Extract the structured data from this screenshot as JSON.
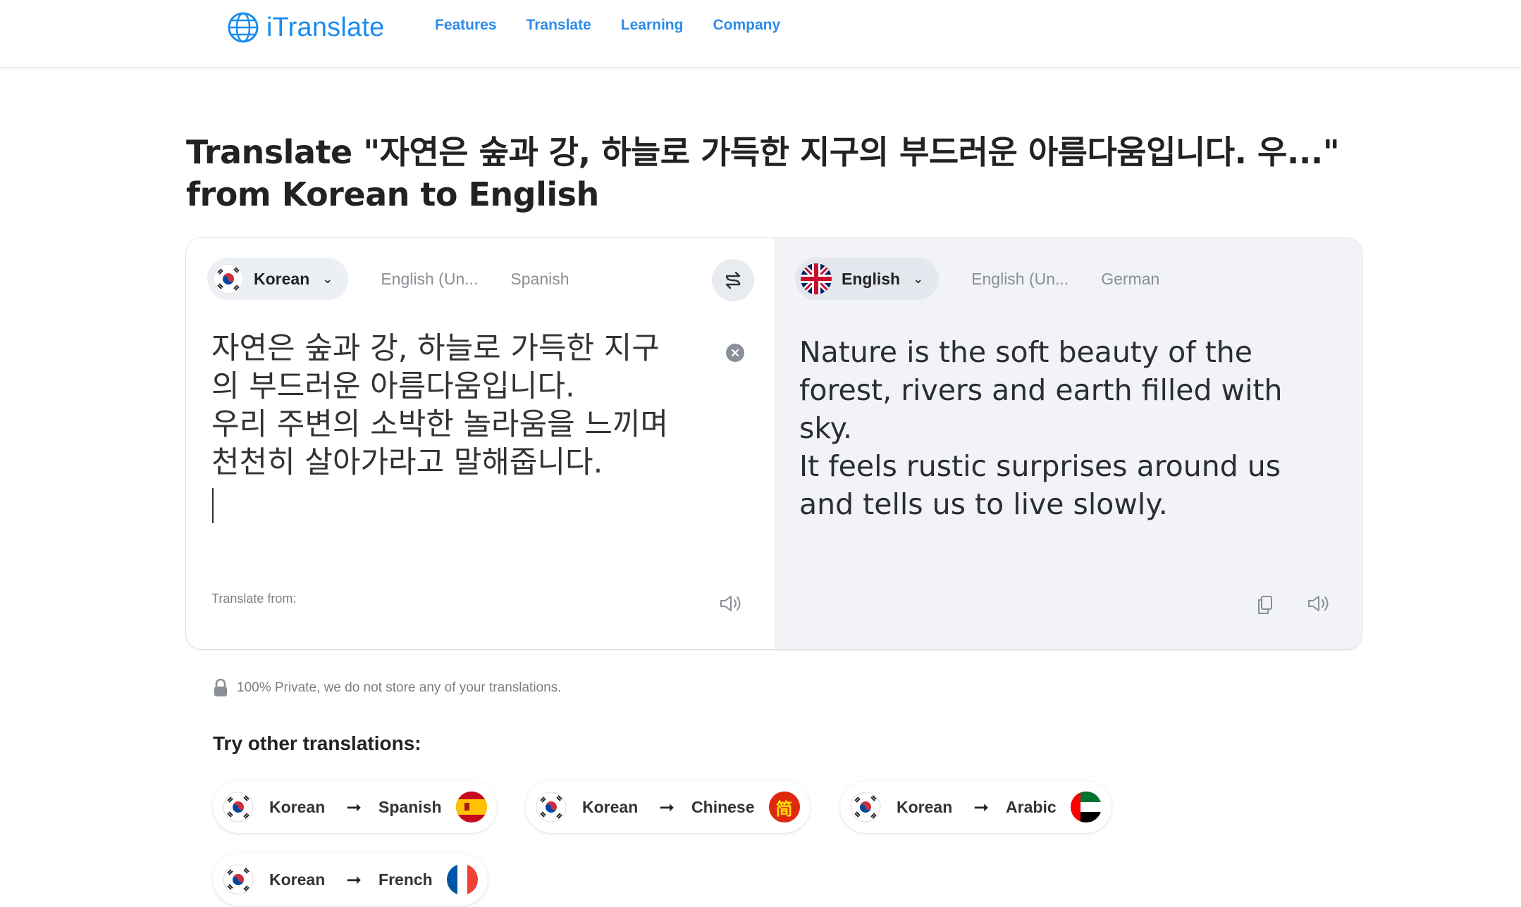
{
  "header": {
    "logo_text": "iTranslate",
    "nav": [
      "Features",
      "Translate",
      "Learning",
      "Company"
    ]
  },
  "title": "Translate \"자연은 숲과 강, 하늘로 가득한 지구의 부드러운 아름다움입니다. 우...\" from Korean to English",
  "source": {
    "selected_language": "Korean",
    "options": [
      "English (Un...",
      "Spanish"
    ],
    "text": "자연은 숲과 강, 하늘로 가득한 지구\n의 부드러운 아름다움입니다.\n우리 주변의 소박한 놀라움을 느끼며\n천천히 살아가라고 말해줍니다.",
    "translate_from_label": "Translate from:"
  },
  "target": {
    "selected_language": "English",
    "options": [
      "English (Un...",
      "German"
    ],
    "text": "Nature is the soft beauty of the\nforest, rivers and earth filled with\nsky.\nIt feels rustic surprises around us\nand tells us to live slowly."
  },
  "privacy_note": "100% Private, we do not store any of your translations.",
  "other_translations": {
    "title": "Try other translations:",
    "pairs": [
      {
        "from": "Korean",
        "to": "Spanish"
      },
      {
        "from": "Korean",
        "to": "Chinese"
      },
      {
        "from": "Korean",
        "to": "Arabic"
      },
      {
        "from": "Korean",
        "to": "French"
      }
    ],
    "chinese_flag_char": "简"
  },
  "colors": {
    "brand_blue": "#1a8cf0",
    "nav_blue": "#2e8bea",
    "target_pane_bg": "#f1f3f6"
  },
  "icons": [
    "globe-icon",
    "chevron-down-icon",
    "swap-icon",
    "clear-icon",
    "speaker-icon",
    "copy-icon",
    "lock-icon",
    "arrow-right-icon"
  ]
}
